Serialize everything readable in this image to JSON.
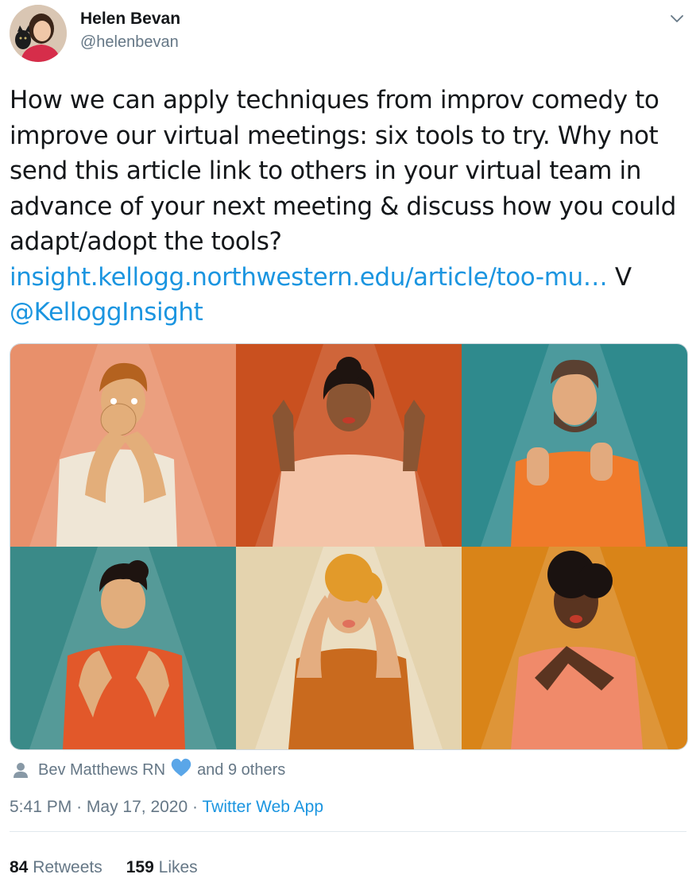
{
  "author": {
    "name": "Helen Bevan",
    "handle": "@helenbevan"
  },
  "tweet": {
    "text": "How we can apply techniques from improv comedy to improve our virtual meetings: six tools to try. Why not send this article link to others in your virtual team in advance of your next meeting & discuss how you could adapt/adopt the tools?",
    "link": "insight.kellogg.northwestern.edu/article/too-mu…",
    "via": "V",
    "mention": "@KelloggInsight"
  },
  "likers": {
    "name": "Bev Matthews RN",
    "suffix": "and 9 others"
  },
  "meta": {
    "time": "5:41 PM",
    "sep1": "·",
    "date": "May 17, 2020",
    "sep2": "·",
    "source": "Twitter Web App"
  },
  "stats": {
    "retweets_count": "84",
    "retweets_label": "Retweets",
    "likes_count": "159",
    "likes_label": "Likes"
  },
  "colors": {
    "link": "#1b95e0",
    "secondary": "#657786"
  }
}
